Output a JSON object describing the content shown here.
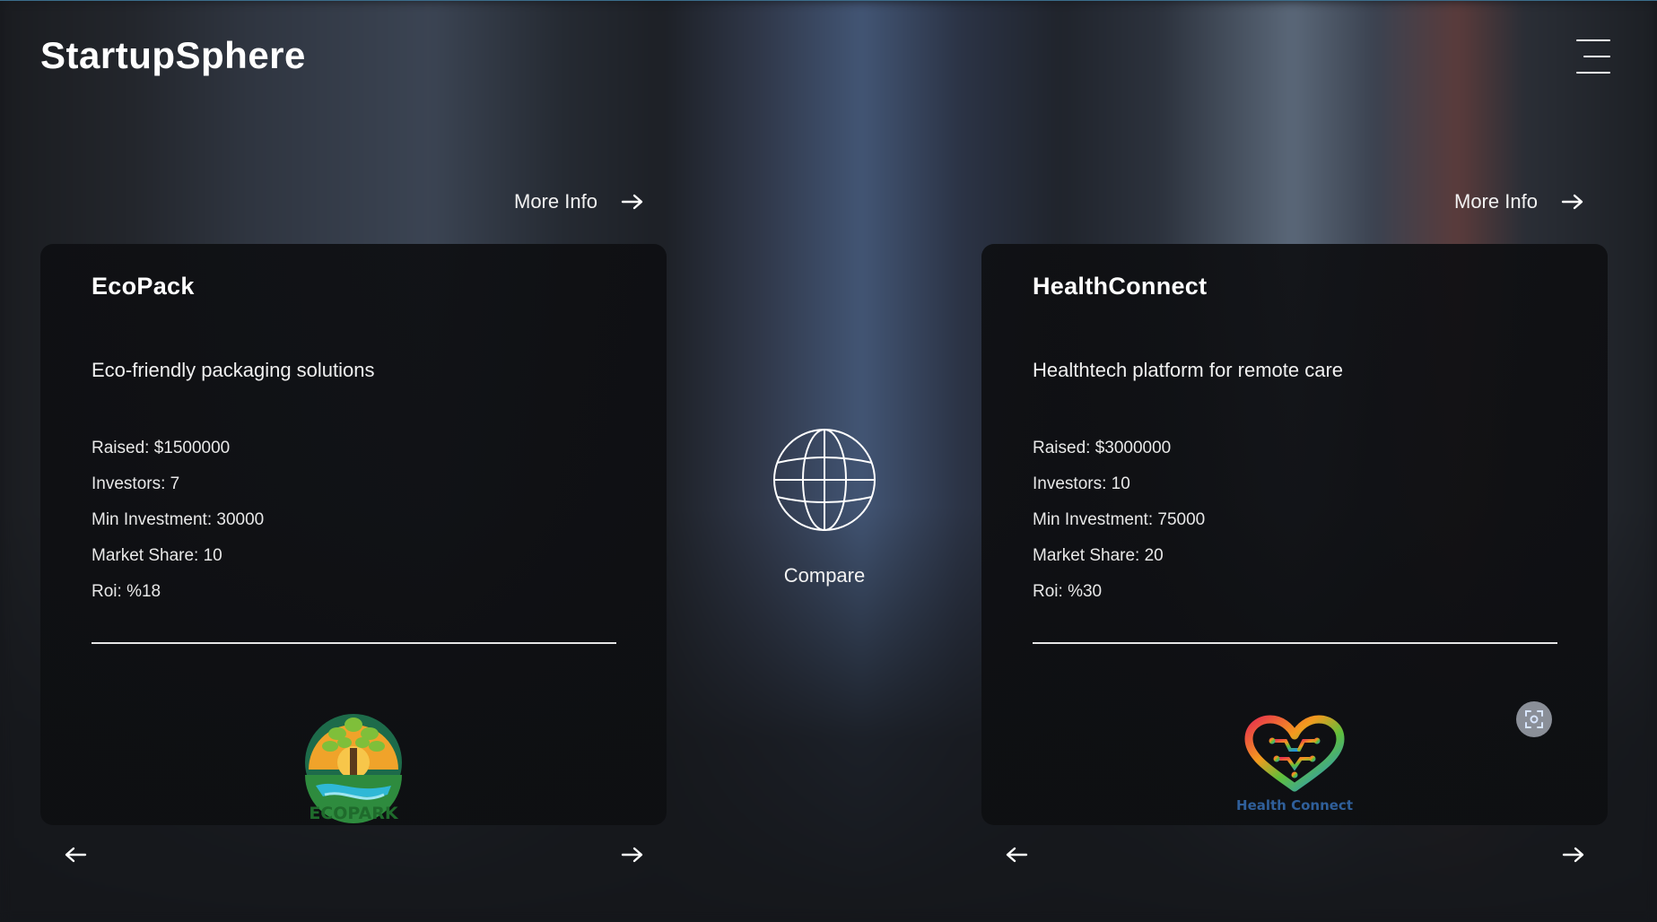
{
  "app": {
    "title": "StartupSphere"
  },
  "compare": {
    "label": "Compare"
  },
  "cards": [
    {
      "more_info": "More Info",
      "name": "EcoPack",
      "description": "Eco-friendly packaging solutions",
      "stats": {
        "raised": "Raised: $1500000",
        "investors": "Investors: 7",
        "min_investment": "Min Investment: 30000",
        "market_share": "Market Share: 10",
        "roi": "Roi: %18"
      },
      "logo_text": "ECOPARK"
    },
    {
      "more_info": "More Info",
      "name": "HealthConnect",
      "description": "Healthtech platform for remote care",
      "stats": {
        "raised": "Raised: $3000000",
        "investors": "Investors: 10",
        "min_investment": "Min Investment: 75000",
        "market_share": "Market Share: 20",
        "roi": "Roi: %30"
      },
      "logo_text": "Health Connect"
    }
  ],
  "icons": {
    "menu": "hamburger-menu-icon",
    "more_info": "arrow-right-icon",
    "prev": "arrow-left-icon",
    "next": "arrow-right-icon",
    "compare": "globe-icon",
    "scan": "scan-icon"
  },
  "colors": {
    "background": "#15171b",
    "card": "#0e0f12",
    "text": "#ffffff",
    "accent_line": "#3b6e8c"
  }
}
